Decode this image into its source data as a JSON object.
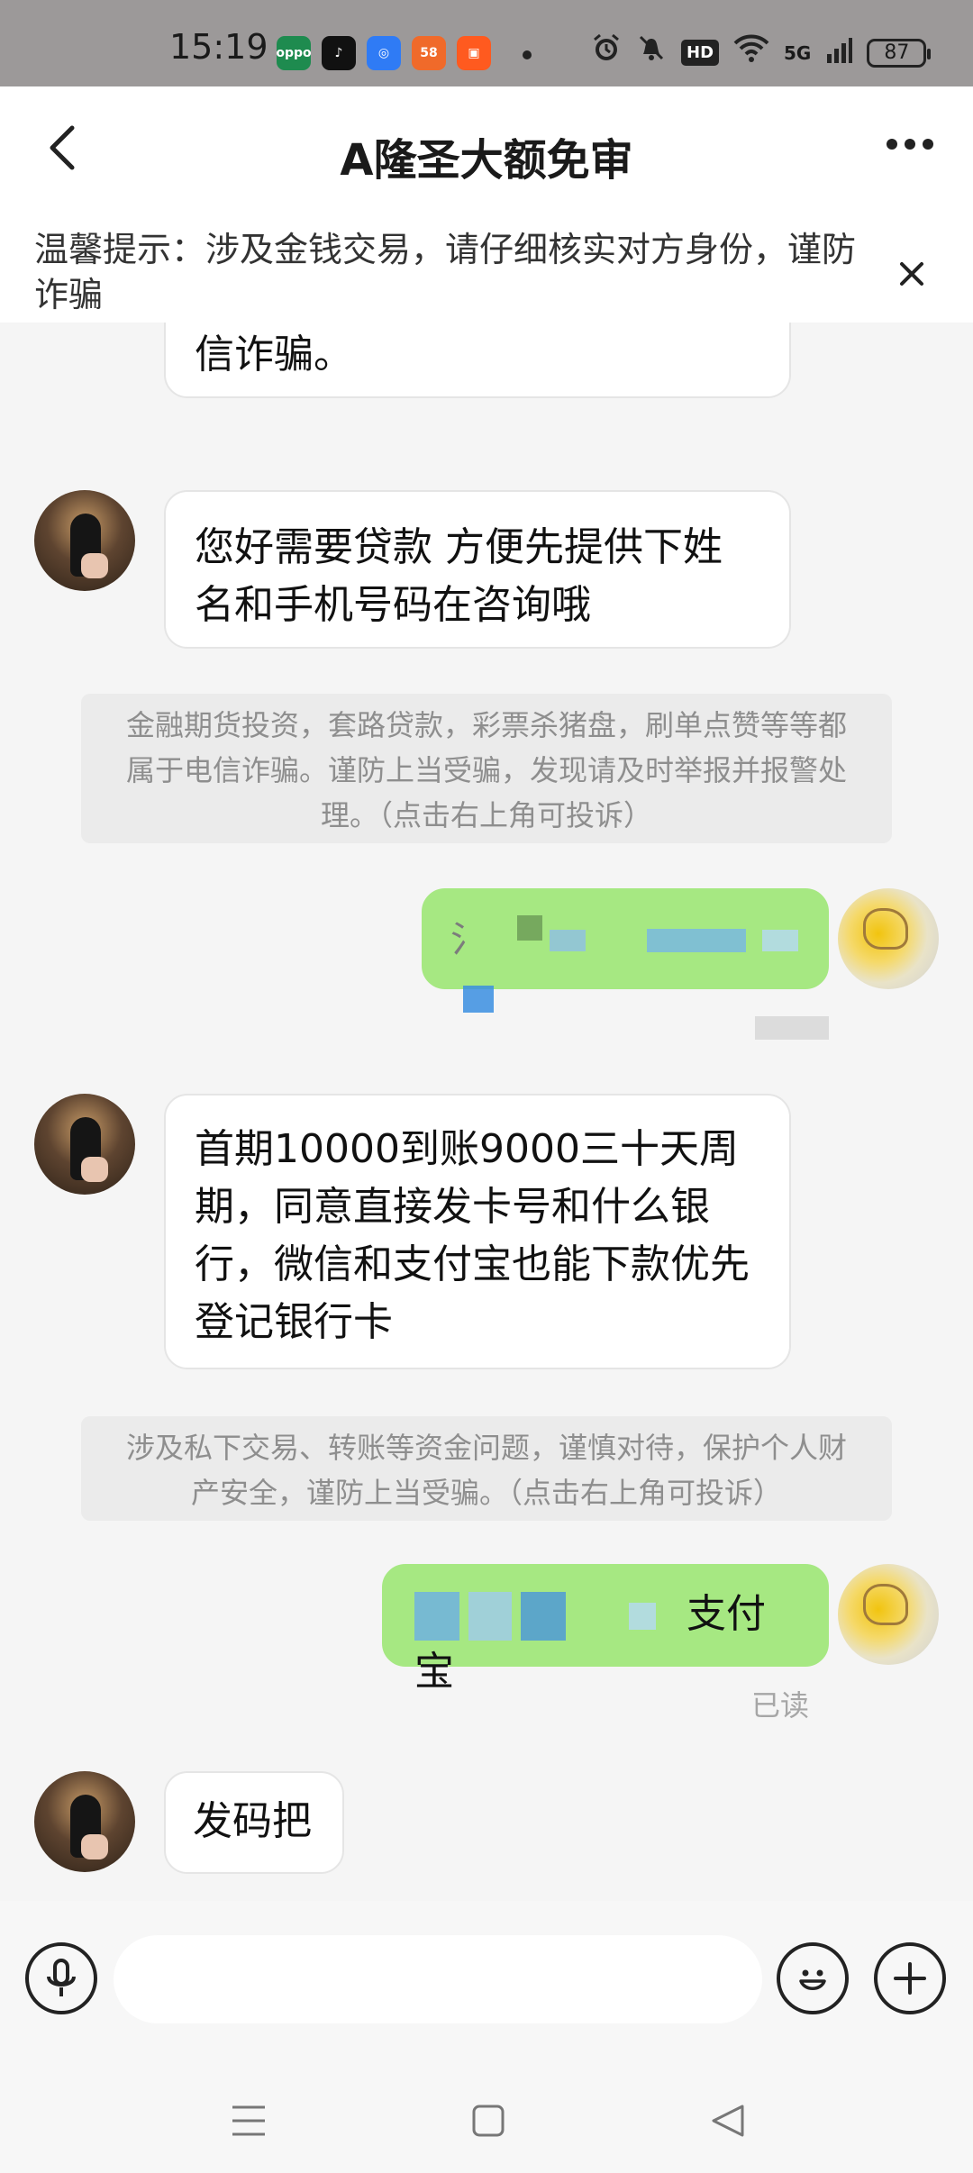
{
  "status_bar": {
    "time": "15:19",
    "apps": [
      {
        "icon": "oppo-app-icon",
        "color": "#1e8b4f",
        "text": "oppo"
      },
      {
        "icon": "tiktok-icon",
        "color": "#111111",
        "text": "♪"
      },
      {
        "icon": "ai-app-icon",
        "color": "#2f7bf5",
        "text": "◎"
      },
      {
        "icon": "58-app-icon",
        "color": "#f06a2a",
        "text": "58"
      },
      {
        "icon": "kuaishou-icon",
        "color": "#ff5a1f",
        "text": "▣"
      }
    ],
    "network": "5G",
    "hd_label": "HD",
    "battery": "87"
  },
  "header": {
    "title": "A隆圣大额免审"
  },
  "notice": {
    "text": "温馨提示：涉及金钱交易，请仔细核实对方身份，谨防诈骗"
  },
  "messages": {
    "m0": {
      "from": "other",
      "text": "人聊天请核实对方身份，谨防电信诈骗。"
    },
    "m1": {
      "from": "other",
      "line1": "您好需要贷款 方便先提供下姓",
      "line2": "名和手机号码在咨询哦"
    },
    "s1": {
      "from": "system",
      "line1": "金融期货投资，套路贷款，彩票杀猪盘，刷单点赞等等都",
      "line2": "属于电信诈骗。谨防上当受骗，发现请及时举报并报警处",
      "line3": "理。（点击右上角可投诉）"
    },
    "m2": {
      "from": "me",
      "text": "氵"
    },
    "m3": {
      "from": "other",
      "line1": "首期10000到账9000三十天周",
      "line2": "期，同意直接发卡号和什么银",
      "line3": "行，微信和支付宝也能下款优先",
      "line4": "登记银行卡"
    },
    "s2": {
      "from": "system",
      "line1": "涉及私下交易、转账等资金问题，谨慎对待，保护个人财",
      "line2": "产安全，谨防上当受骗。（点击右上角可投诉）"
    },
    "m4": {
      "from": "me",
      "text": "支付宝",
      "status": "已读"
    },
    "m5": {
      "from": "other",
      "text": "发码把"
    }
  },
  "input_bar": {
    "placeholder": ""
  },
  "colors": {
    "status_bg": "#9c9999",
    "my_bubble": "#a6e882",
    "chat_bg": "#f5f5f5",
    "link_blue": "#3a8ee0"
  }
}
